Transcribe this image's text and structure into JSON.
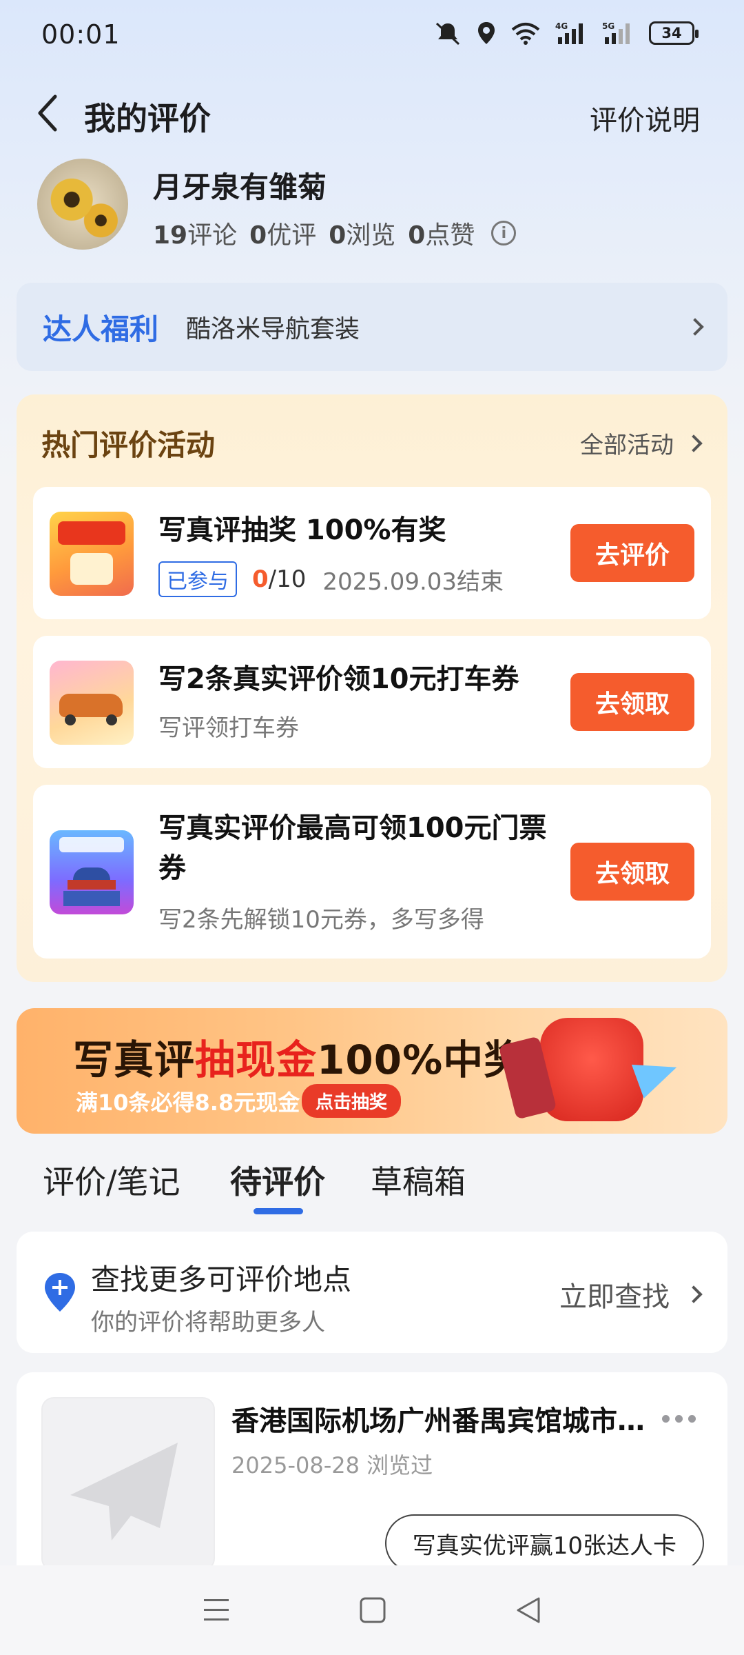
{
  "status": {
    "time": "00:01",
    "battery": "34"
  },
  "header": {
    "title": "我的评价",
    "help": "评价说明"
  },
  "profile": {
    "name": "月牙泉有雏菊",
    "reviews_num": "19",
    "reviews_label": "评论",
    "good_num": "0",
    "good_label": "优评",
    "views_num": "0",
    "views_label": "浏览",
    "likes_num": "0",
    "likes_label": "点赞"
  },
  "benefit": {
    "tag": "达人福利",
    "text": "酷洛米导航套装"
  },
  "activities": {
    "title": "热门评价活动",
    "all_label": "全部活动",
    "items": [
      {
        "title": "写真评抽奖 100%有奖",
        "badge": "已参与",
        "progress_done": "0",
        "progress_total": "/10",
        "end": "2025.09.03结束",
        "button": "去评价"
      },
      {
        "title": "写2条真实评价领10元打车券",
        "sub": "写评领打车券",
        "button": "去领取"
      },
      {
        "title": "写真实评价最高可领100元门票券",
        "sub": "写2条先解锁10元券，多写多得",
        "button": "去领取"
      }
    ]
  },
  "promo": {
    "title_a": "写真评",
    "title_b": "抽现金",
    "title_c": "100%中奖",
    "sub": "满10条必得8.8元现金",
    "button": "点击抽奖"
  },
  "tabs": [
    "评价/笔记",
    "待评价",
    "草稿箱"
  ],
  "find": {
    "title": "查找更多可评价地点",
    "sub": "你的评价将帮助更多人",
    "link": "立即查找"
  },
  "place": {
    "title": "香港国际机场广州番禺宾馆城市候机楼",
    "date": "2025-08-28 浏览过",
    "button": "写真实优评赢10张达人卡"
  },
  "colors": {
    "accent": "#2f6ce4",
    "action": "#f55c2d",
    "activity_bg": "#fdf0d5"
  }
}
